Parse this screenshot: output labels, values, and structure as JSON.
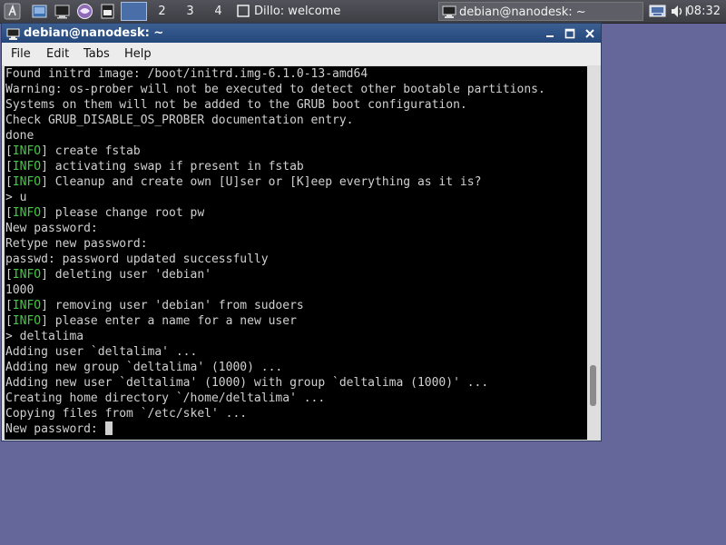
{
  "taskbar": {
    "launchers": [
      "menu-icon",
      "desktop-icon",
      "terminal-icon",
      "browser-icon",
      "editor-icon"
    ],
    "workspaces": [
      {
        "label": "",
        "active": true
      },
      {
        "label": "2",
        "active": false
      },
      {
        "label": "3",
        "active": false
      },
      {
        "label": "4",
        "active": false
      }
    ],
    "tasks": [
      {
        "label": "Dillo: welcome",
        "icon": "window-icon",
        "active": false
      },
      {
        "label": "debian@nanodesk: ~",
        "icon": "terminal-icon",
        "active": true
      }
    ],
    "tray": [
      "keyboard-icon",
      "volume-icon",
      "network-icon"
    ],
    "clock": "08:32"
  },
  "window": {
    "title": "debian@nanodesk: ~",
    "controls": [
      "minimize-icon",
      "maximize-icon",
      "close-icon"
    ],
    "menu": [
      "File",
      "Edit",
      "Tabs",
      "Help"
    ]
  },
  "terminal": {
    "info_tag": "INFO",
    "lines": [
      {
        "text": "Found initrd image: /boot/initrd.img-6.1.0-13-amd64"
      },
      {
        "text": "Warning: os-prober will not be executed to detect other bootable partitions."
      },
      {
        "text": "Systems on them will not be added to the GRUB boot configuration."
      },
      {
        "text": "Check GRUB_DISABLE_OS_PROBER documentation entry."
      },
      {
        "text": "done"
      },
      {
        "info": true,
        "text": " create fstab"
      },
      {
        "info": true,
        "text": " activating swap if present in fstab"
      },
      {
        "info": true,
        "text": " Cleanup and create own [U]ser or [K]eep everything as it is?"
      },
      {
        "text": "> u"
      },
      {
        "info": true,
        "text": " please change root pw"
      },
      {
        "text": "New password:"
      },
      {
        "text": "Retype new password:"
      },
      {
        "text": "passwd: password updated successfully"
      },
      {
        "info": true,
        "text": " deleting user 'debian'"
      },
      {
        "text": "1000"
      },
      {
        "info": true,
        "text": " removing user 'debian' from sudoers"
      },
      {
        "info": true,
        "text": " please enter a name for a new user"
      },
      {
        "text": "> deltalima"
      },
      {
        "text": "Adding user `deltalima' ..."
      },
      {
        "text": "Adding new group `deltalima' (1000) ..."
      },
      {
        "text": "Adding new user `deltalima' (1000) with group `deltalima (1000)' ..."
      },
      {
        "text": "Creating home directory `/home/deltalima' ..."
      },
      {
        "text": "Copying files from `/etc/skel' ..."
      },
      {
        "text": "New password: ",
        "cursor": true
      }
    ],
    "scroll_position": 0.9,
    "scroll_visible_fraction": 0.11
  },
  "colors": {
    "desktop": "#65679a",
    "titlebar": "#2d4f86",
    "info_green": "#45c845",
    "terminal_bg": "#000000",
    "terminal_fg": "#d0d0d0"
  }
}
